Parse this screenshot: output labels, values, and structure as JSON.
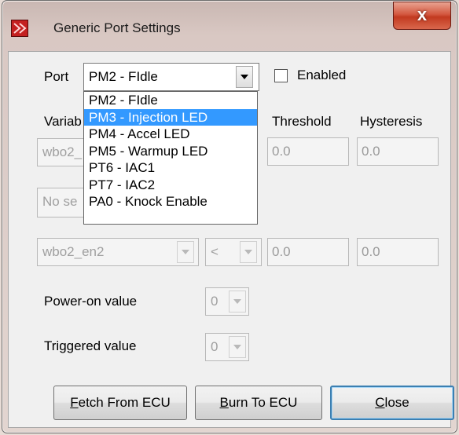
{
  "window": {
    "title": "Generic Port Settings",
    "close_glyph": "x"
  },
  "port": {
    "label": "Port",
    "selected": "PM2 - FIdle",
    "options": [
      "PM2 - FIdle",
      "PM3 - Injection LED",
      "PM4 - Accel LED",
      "PM5 - Warmup LED",
      "PT6 - IAC1",
      "PT7 - IAC2",
      "PA0 - Knock Enable"
    ],
    "highlighted_index": 1
  },
  "enabled": {
    "label": "Enabled",
    "checked": false
  },
  "headers": {
    "variable_partial": "Variab",
    "threshold": "Threshold",
    "hysteresis": "Hysteresis"
  },
  "rows": [
    {
      "variable_partial": "wbo2_",
      "threshold": "0.0",
      "hysteresis": "0.0"
    },
    {
      "variable_partial": "No se"
    },
    {
      "variable": "wbo2_en2",
      "operator": "<",
      "threshold": "0.0",
      "hysteresis": "0.0"
    }
  ],
  "power_on": {
    "label": "Power-on value",
    "value": "0"
  },
  "triggered": {
    "label": "Triggered value",
    "value": "0"
  },
  "buttons": {
    "fetch": {
      "mnemonic": "F",
      "rest": "etch From ECU"
    },
    "burn": {
      "mnemonic": "B",
      "rest": "urn To ECU"
    },
    "close": {
      "mnemonic": "C",
      "rest": "lose"
    }
  },
  "colors": {
    "selection": "#3399ff",
    "close_button": "#c94a33",
    "app_icon": "#c42020"
  }
}
